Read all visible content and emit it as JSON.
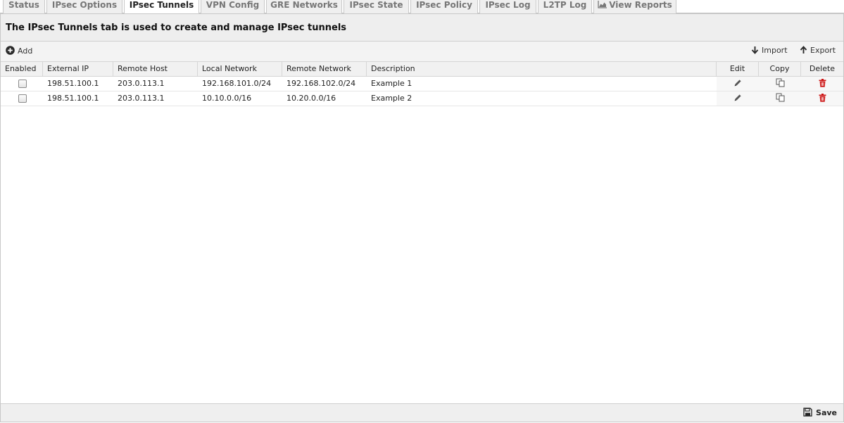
{
  "tabs": [
    {
      "label": "Status",
      "active": false
    },
    {
      "label": "IPsec Options",
      "active": false
    },
    {
      "label": "IPsec Tunnels",
      "active": true
    },
    {
      "label": "VPN Config",
      "active": false
    },
    {
      "label": "GRE Networks",
      "active": false
    },
    {
      "label": "IPsec State",
      "active": false
    },
    {
      "label": "IPsec Policy",
      "active": false
    },
    {
      "label": "IPsec Log",
      "active": false
    },
    {
      "label": "L2TP Log",
      "active": false
    },
    {
      "label": "View Reports",
      "active": false,
      "icon": "area-chart-icon"
    }
  ],
  "header": {
    "title": "The IPsec Tunnels tab is used to create and manage IPsec tunnels"
  },
  "toolbar": {
    "add_label": "Add",
    "import_label": "Import",
    "export_label": "Export"
  },
  "grid": {
    "columns": [
      "Enabled",
      "External IP",
      "Remote Host",
      "Local Network",
      "Remote Network",
      "Description",
      "Edit",
      "Copy",
      "Delete"
    ],
    "rows": [
      {
        "enabled": false,
        "external_ip": "198.51.100.1",
        "remote_host": "203.0.113.1",
        "local_network": "192.168.101.0/24",
        "remote_network": "192.168.102.0/24",
        "description": "Example 1"
      },
      {
        "enabled": false,
        "external_ip": "198.51.100.1",
        "remote_host": "203.0.113.1",
        "local_network": "10.10.0.0/16",
        "remote_network": "10.20.0.0/16",
        "description": "Example 2"
      }
    ]
  },
  "footer": {
    "save_label": "Save"
  },
  "colors": {
    "delete_icon": "#cc1111",
    "active_tab_bg": "#ffffff",
    "inactive_tab_bg": "#efefef"
  }
}
